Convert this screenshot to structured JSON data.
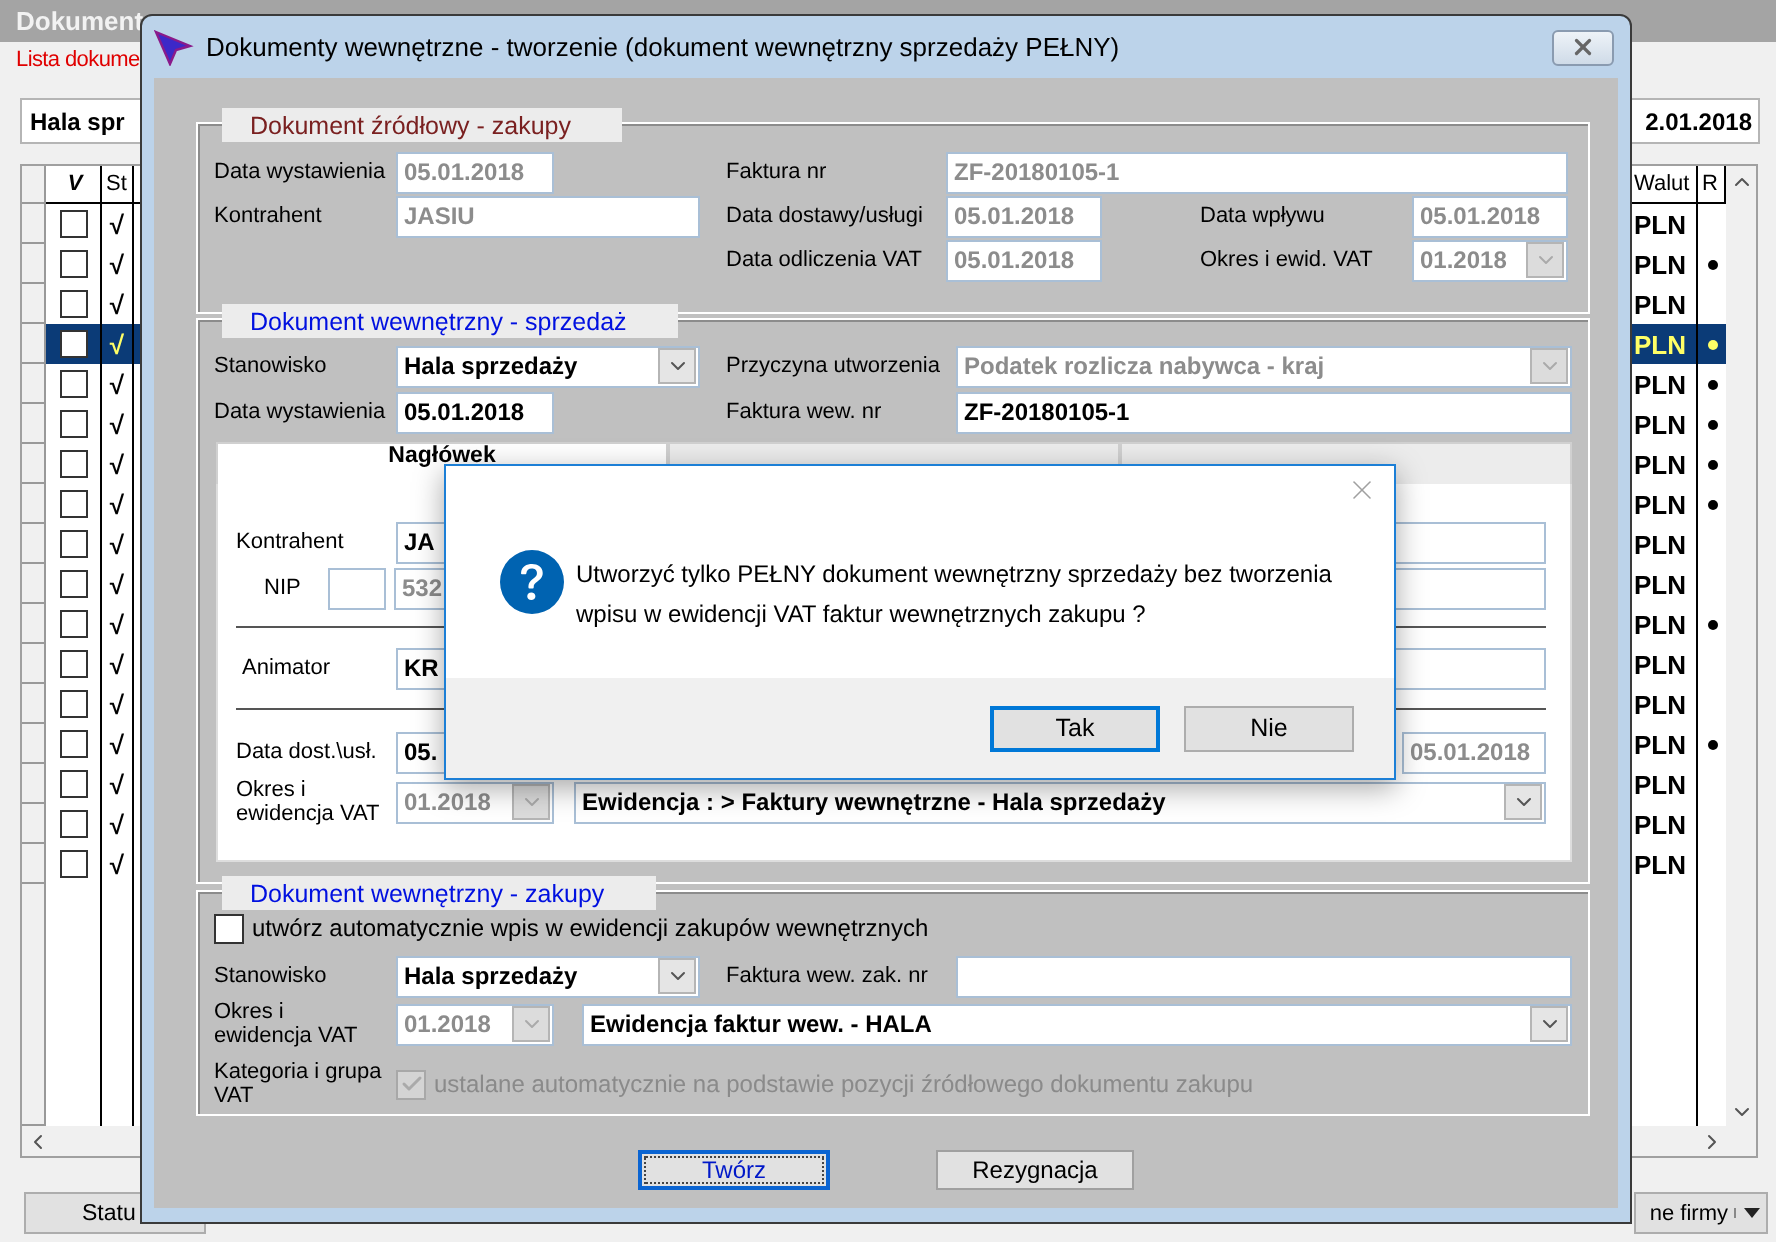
{
  "background_window": {
    "title": "Dokument",
    "list_link": "Lista dokume",
    "filter": {
      "station": "Hala spr",
      "date": "2.01.2018"
    },
    "table": {
      "columns": [
        "V",
        "St",
        "Walut",
        "R"
      ],
      "rows": [
        {
          "checked": false,
          "status": "√",
          "currency": "PLN",
          "marked": false,
          "selected": false
        },
        {
          "checked": false,
          "status": "√",
          "currency": "PLN",
          "marked": true,
          "selected": false
        },
        {
          "checked": false,
          "status": "√",
          "currency": "PLN",
          "marked": false,
          "selected": false
        },
        {
          "checked": false,
          "status": "√",
          "currency": "PLN",
          "marked": true,
          "selected": true
        },
        {
          "checked": false,
          "status": "√",
          "currency": "PLN",
          "marked": true,
          "selected": false
        },
        {
          "checked": false,
          "status": "√",
          "currency": "PLN",
          "marked": true,
          "selected": false
        },
        {
          "checked": false,
          "status": "√",
          "currency": "PLN",
          "marked": true,
          "selected": false
        },
        {
          "checked": false,
          "status": "√",
          "currency": "PLN",
          "marked": true,
          "selected": false
        },
        {
          "checked": false,
          "status": "√",
          "currency": "PLN",
          "marked": false,
          "selected": false
        },
        {
          "checked": false,
          "status": "√",
          "currency": "PLN",
          "marked": false,
          "selected": false
        },
        {
          "checked": false,
          "status": "√",
          "currency": "PLN",
          "marked": true,
          "selected": false
        },
        {
          "checked": false,
          "status": "√",
          "currency": "PLN",
          "marked": false,
          "selected": false
        },
        {
          "checked": false,
          "status": "√",
          "currency": "PLN",
          "marked": false,
          "selected": false
        },
        {
          "checked": false,
          "status": "√",
          "currency": "PLN",
          "marked": true,
          "selected": false
        },
        {
          "checked": false,
          "status": "√",
          "currency": "PLN",
          "marked": false,
          "selected": false
        },
        {
          "checked": false,
          "status": "√",
          "currency": "PLN",
          "marked": false,
          "selected": false
        },
        {
          "checked": false,
          "status": "√",
          "currency": "PLN",
          "marked": false,
          "selected": false
        }
      ]
    },
    "buttons": [
      "Statu",
      "ne firmy"
    ]
  },
  "dialog": {
    "title": "Dokumenty wewnętrzne - tworzenie (dokument wewnętrzny sprzedaży PEŁNY)",
    "source": {
      "title": "Dokument źródłowy - zakupy",
      "issue_date": {
        "label": "Data wystawienia",
        "value": "05.01.2018",
        "disabled": true
      },
      "contractor": {
        "label": "Kontrahent",
        "value": "JASIU",
        "disabled": true
      },
      "invoice": {
        "label": "Faktura nr",
        "value": "ZF-20180105-1",
        "disabled": true
      },
      "delivery_date": {
        "label": "Data dostawy/usługi",
        "value": "05.01.2018",
        "disabled": true
      },
      "receipt_date": {
        "label": "Data wpływu",
        "value": "05.01.2018",
        "disabled": true
      },
      "vat_date": {
        "label": "Data odliczenia VAT",
        "value": "05.01.2018",
        "disabled": true
      },
      "vat_period": {
        "label": "Okres i ewid. VAT",
        "value": "01.2018",
        "disabled": true
      }
    },
    "sale": {
      "title": "Dokument wewnętrzny - sprzedaż",
      "station": {
        "label": "Stanowisko",
        "value": "Hala sprzedaży",
        "disabled": false
      },
      "reason": {
        "label": "Przyczyna utworzenia",
        "value": "Podatek rozlicza nabywca - kraj",
        "disabled": true
      },
      "issue_date": {
        "label": "Data wystawienia",
        "value": "05.01.2018",
        "disabled": false
      },
      "internal_invoice": {
        "label": "Faktura wew. nr",
        "value": "ZF-20180105-1",
        "disabled": false
      },
      "tabs": [
        {
          "label": "Nagłówek",
          "selected": true
        },
        {
          "selected": false
        },
        {
          "selected": false
        }
      ],
      "contractor": {
        "label": "Kontrahent",
        "value": "JA",
        "disabled": false
      },
      "nip": {
        "label": "NIP",
        "value": "532",
        "disabled": true
      },
      "animator": {
        "label": "Animator",
        "value": "KR",
        "disabled": false
      },
      "delivery_date": {
        "label": "Data dost.\\usł.",
        "value": "05.",
        "disabled": false
      },
      "delivery_date_2": {
        "value": "05.01.2018",
        "disabled": true
      },
      "vat_period": {
        "label": "Okres i ewidencja VAT",
        "value": "01.2018",
        "disabled": true
      },
      "vat_register": {
        "value": "Ewidencja : > Faktury wewnętrzne - Hala sprzedaży",
        "disabled": false
      }
    },
    "purchase": {
      "title": "Dokument wewnętrzny - zakupy",
      "auto_entry": {
        "label": "utwórz automatycznie wpis w ewidencji zakupów wewnętrznych",
        "checked": false,
        "disabled": false
      },
      "station": {
        "label": "Stanowisko",
        "value": "Hala sprzedaży",
        "disabled": false
      },
      "internal_invoice": {
        "label": "Faktura wew. zak. nr"
      },
      "vat_period": {
        "label": "Okres i ewidencja VAT",
        "value": "01.2018",
        "disabled": true
      },
      "vat_register": {
        "value": "Ewidencja faktur wew. - HALA",
        "disabled": false
      },
      "category": {
        "label": "Kategoria i grupa VAT",
        "text": "ustalane automatycznie na podstawie pozycji źródłowego dokumentu zakupu",
        "checked": true,
        "disabled": true
      }
    },
    "buttons": [
      {
        "label": "Twórz",
        "focused": true
      },
      {
        "label": "Rezygnacja",
        "focused": false
      }
    ]
  },
  "message_box": {
    "text_lines": [
      "Utworzyć tylko PEŁNY dokument wewnętrzny sprzedaży bez tworzenia",
      "wpisu w ewidencji VAT faktur wewnętrznych zakupu ?"
    ],
    "buttons": [
      {
        "label": "Tak",
        "focused": true
      },
      {
        "label": "Nie",
        "focused": false
      }
    ]
  }
}
